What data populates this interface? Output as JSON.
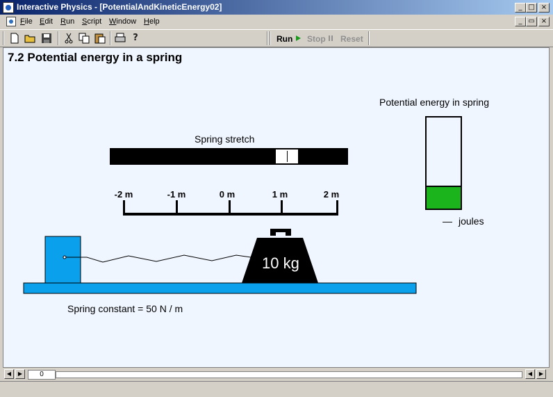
{
  "window": {
    "title": "Interactive Physics - [PotentialAndKineticEnergy02]",
    "controls": [
      "_",
      "□",
      "×"
    ],
    "doc_controls": [
      "_",
      "▭",
      "×"
    ]
  },
  "menu": [
    "File",
    "Edit",
    "Run",
    "Script",
    "Window",
    "Help"
  ],
  "toolbar": {
    "run_label": "Run",
    "stop_label": "Stop",
    "reset_label": "Reset"
  },
  "page": {
    "heading": "7.2 Potential energy in a spring",
    "spring_stretch_label": "Spring stretch",
    "scale_ticks": [
      "-2 m",
      "-1 m",
      "0 m",
      "1 m",
      "2 m"
    ],
    "mass_label": "10 kg",
    "spring_constant_text": "Spring constant = 50 N / m",
    "pe_label": "Potential energy in spring",
    "pe_units": "joules",
    "pe_value": "—",
    "pe_fraction": 0.25,
    "stretch_slider_value_m": 1.0
  },
  "frame": {
    "counter": "0"
  },
  "colors": {
    "block": "#0aa0ec",
    "floor": "#0aa0ec",
    "pe_fill": "#1cb41c",
    "mass": "#000000"
  }
}
